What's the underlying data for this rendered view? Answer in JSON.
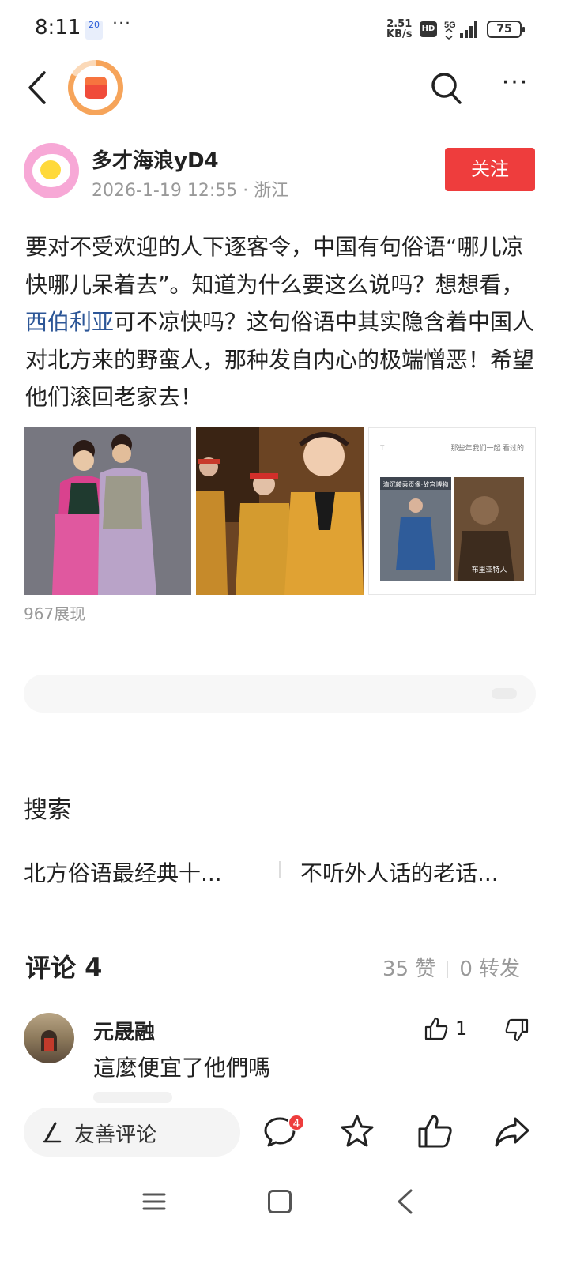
{
  "status_bar": {
    "time": "8:11",
    "notif": "20",
    "dots": "···",
    "speed_top": "2.51",
    "speed_bottom": "KB/s",
    "hd": "HD",
    "network": "5G",
    "battery": "75"
  },
  "nav": {
    "back_icon": "chevron-left-icon",
    "reward_icon": "red-packet-icon",
    "search_icon": "search-icon",
    "more_icon": "more-icon",
    "more_glyph": "···"
  },
  "author": {
    "name": "多才海浪yD4",
    "meta": "2026-1-19 12:55 · 浙江",
    "follow_label": "关注"
  },
  "post": {
    "text_before": "要对不受欢迎的人下逐客令，中国有句俗语“哪儿凉快哪儿呆着去”。知道为什么要这么说吗？想想看，",
    "link_text": "西伯利亚",
    "text_after": "可不凉快吗？这句俗语中其实隐含着中国人对北方来的野蛮人，那种发自内心的极端憎恶！希望他们滚回老家去！",
    "image3_caption_left": "清沉麟乘贡像·故宫博物",
    "image3_caption_right": "布里亚特人",
    "image3_header": "那些年我们一起 看过的",
    "views": "967展现"
  },
  "search": {
    "title": "搜索",
    "suggestions": [
      "北方俗语最经典十...",
      "不听外人话的老话..."
    ]
  },
  "comments": {
    "title": "评论 4",
    "likes": "35 赞",
    "reposts": "0 转发",
    "items": [
      {
        "name": "元晟融",
        "text": "這麼便宜了他們嗎",
        "like_count": "1"
      }
    ]
  },
  "bottom_bar": {
    "placeholder": "友善评论",
    "comment_badge": "4"
  },
  "colors": {
    "accent_red": "#ee3d3d",
    "link_blue": "#2c5697",
    "meta_gray": "#999999"
  }
}
